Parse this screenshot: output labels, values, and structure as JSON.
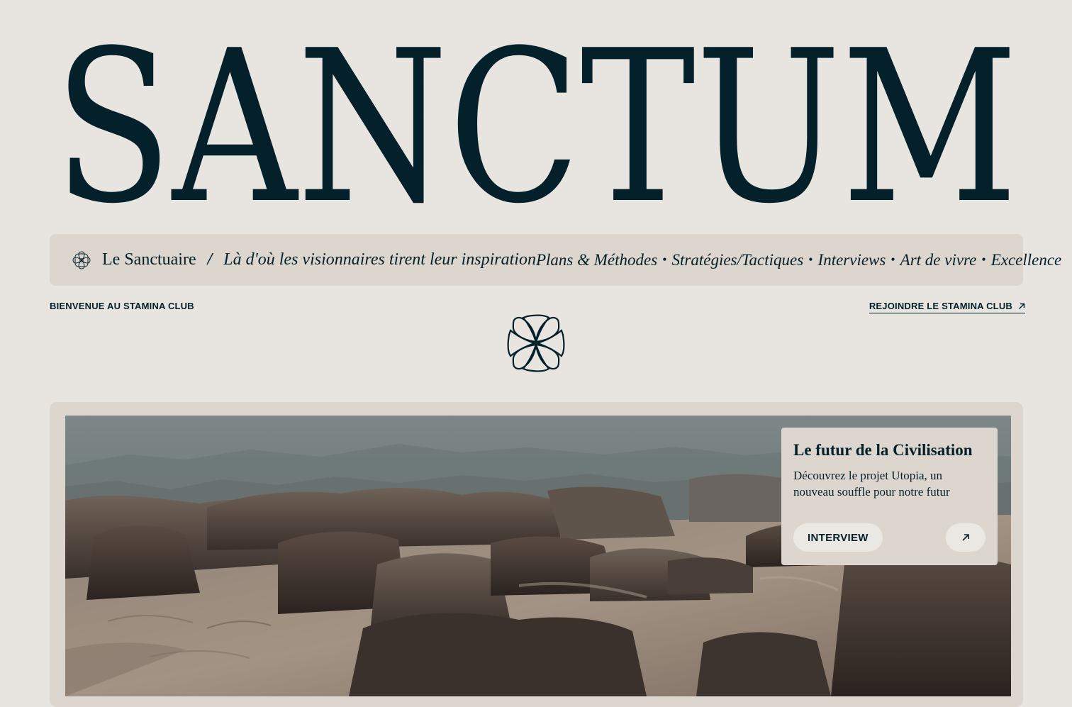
{
  "header": {
    "wordmark": "SANCTUM"
  },
  "navbar": {
    "brand_name": "Le Sanctuaire",
    "brand_separator": "/",
    "tagline": "Là d'où les visionnaires tirent leur inspiration",
    "links": [
      {
        "label": "Plans & Méthodes"
      },
      {
        "label": "Stratégies/Tactiques"
      },
      {
        "label": "Interviews"
      },
      {
        "label": "Art de vivre"
      },
      {
        "label": "Excellence"
      }
    ],
    "link_separator": "•"
  },
  "subheader": {
    "welcome": "BIENVENUE AU STAMINA CLUB",
    "join_label": "REJOINDRE LE STAMINA CLUB"
  },
  "hero": {
    "image_icon": "desert-rock-landscape-image",
    "card": {
      "title": "Le futur de la Civilisation",
      "description": "Découvrez le projet Utopia, un nouveau souffle pour notre futur",
      "button_label": "INTERVIEW",
      "arrow_icon": "arrow-up-right-icon"
    }
  },
  "colors": {
    "background": "#e8e5e0",
    "panel": "#dcd6cf",
    "ink": "#04202a",
    "button": "#ebe8e3"
  }
}
